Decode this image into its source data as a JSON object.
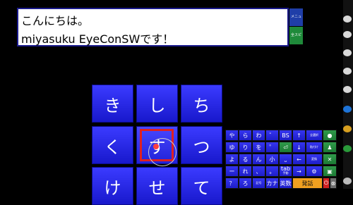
{
  "message": {
    "line1": "こんにちは。",
    "line2": "miyasuku EyeConSWです！"
  },
  "side_buttons": {
    "menu": "メニュー",
    "speak": "全スピー"
  },
  "kana_grid": {
    "rows": [
      [
        "き",
        "し",
        "ち"
      ],
      [
        "く",
        "す",
        "つ"
      ],
      [
        "け",
        "せ",
        "て"
      ]
    ],
    "selected": "す"
  },
  "small_keyboard": {
    "rows": [
      [
        "や",
        "ら",
        "わ",
        "゛",
        "BS",
        "↑",
        "全選択",
        "icon"
      ],
      [
        "ゆ",
        "り",
        "を",
        "゜",
        "⏎",
        "↓",
        "貼付け",
        "icon"
      ],
      [
        "よ",
        "る",
        "ん",
        "小",
        "⎵",
        "←",
        "変換",
        "icon"
      ],
      [
        "ー",
        "れ",
        "、",
        "。",
        "tab",
        "→",
        "icon",
        "icon"
      ],
      [
        "？",
        "ろ",
        "記号",
        "カナ",
        "英数",
        "発話",
        "icon",
        "icon"
      ]
    ],
    "tiny_labels": {
      "tab_sub": "手動",
      "zenkaku": "全角/半角"
    }
  },
  "colors": {
    "key_blue": "#2323e0",
    "select_red": "#e02020",
    "speak_orange": "#f0a020",
    "side_green": "#1f8a3a"
  }
}
